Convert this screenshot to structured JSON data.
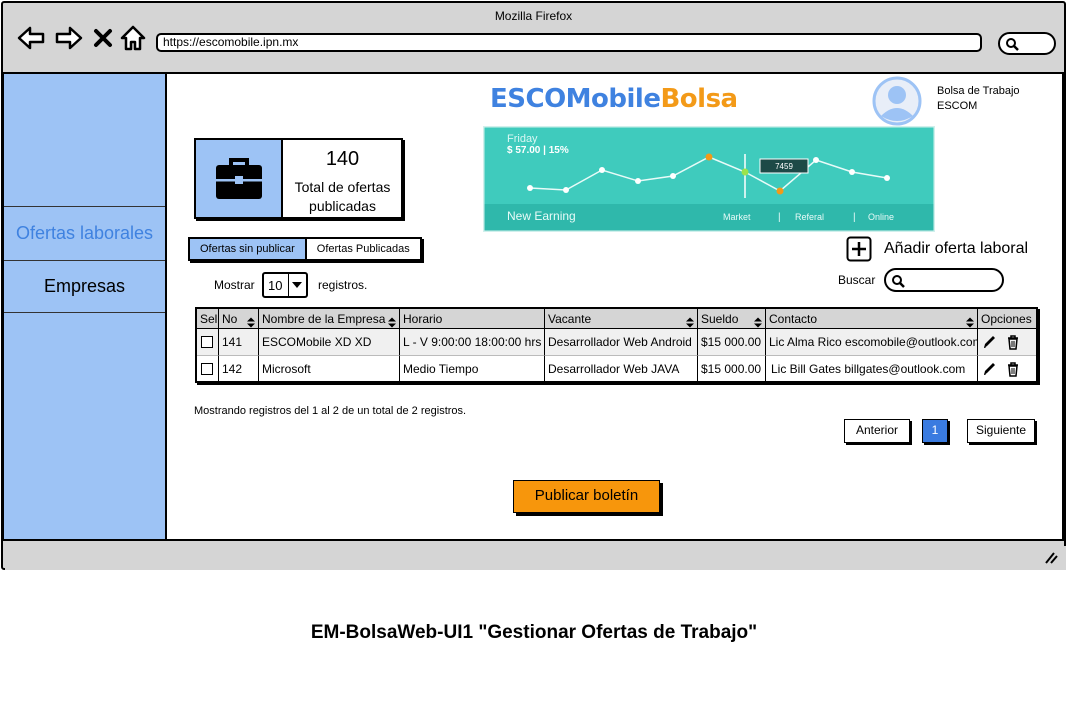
{
  "browser": {
    "title": "Mozilla Firefox",
    "url": "https://escomobile.ipn.mx"
  },
  "sidebar": {
    "items": [
      {
        "label": "Ofertas laborales",
        "active": true
      },
      {
        "label": "Empresas",
        "active": false
      }
    ]
  },
  "brand": {
    "part1": "ESCOMobile",
    "part2": "Bolsa"
  },
  "user": {
    "line1": "Bolsa de Trabajo",
    "line2": "ESCOM"
  },
  "stats": {
    "value": "140",
    "label": "Total de ofertas publicadas"
  },
  "chart": {
    "day": "Friday",
    "amount": "$ 57.00 | 15%",
    "footer_left": "New Earning",
    "footer_links": [
      "Market",
      "Referal",
      "Online"
    ],
    "tooltip": "7459"
  },
  "tabs": [
    {
      "label": "Ofertas sin publicar",
      "active": true
    },
    {
      "label": "Ofertas Publicadas",
      "active": false
    }
  ],
  "add_offer": {
    "label": "Añadir oferta laboral"
  },
  "table_controls": {
    "show_label": "Mostrar",
    "page_size": "10",
    "records_label": "registros.",
    "search_label": "Buscar"
  },
  "table": {
    "columns": [
      "Sel",
      "No",
      "Nombre de la Empresa",
      "Horario",
      "Vacante",
      "Sueldo",
      "Contacto",
      "Opciones"
    ],
    "rows": [
      {
        "no": "141",
        "empresa": "ESCOMobile XD XD",
        "horario": "L - V 9:00:00 18:00:00 hrs",
        "vacante": "Desarrollador Web Android",
        "sueldo": "$15 000.00",
        "contacto": "Lic Alma Rico escomobile@outlook.com"
      },
      {
        "no": "142",
        "empresa": "Microsoft",
        "horario": "Medio Tiempo",
        "vacante": "Desarrollador Web JAVA",
        "sueldo": "$15 000.00",
        "contacto": "Lic Bill Gates billgates@outlook.com"
      }
    ]
  },
  "summary": "Mostrando registros del 1 al 2 de un total de 2 registros.",
  "pagination": {
    "prev": "Anterior",
    "current": "1",
    "next": "Siguiente"
  },
  "publish_button": "Publicar boletín",
  "caption": "EM-BolsaWeb-UI1 \"Gestionar Ofertas de Trabajo\"",
  "colors": {
    "sidebar": "#9dc3f5",
    "brand_blue": "#3f82e0",
    "brand_orange": "#f39a18",
    "chart_bg": "#3fcbbd",
    "publish": "#f7960c"
  }
}
